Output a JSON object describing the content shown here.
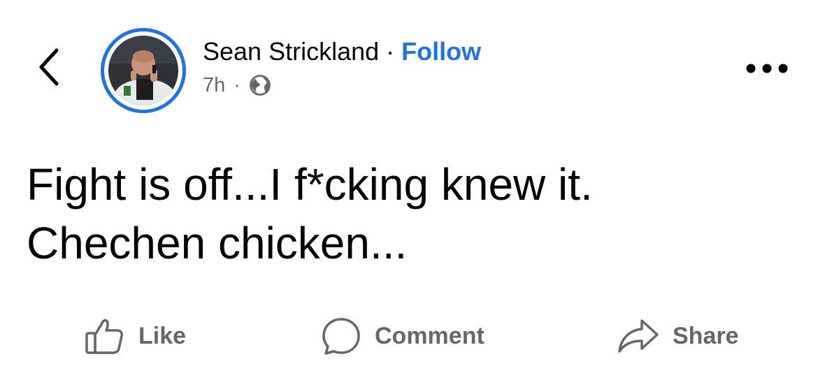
{
  "header": {
    "author_name": "Sean Strickland",
    "separator": "·",
    "follow_label": "Follow",
    "timestamp": "7h",
    "meta_separator": "·",
    "audience_icon": "globe-icon",
    "back_icon": "chevron-left-icon",
    "more_icon": "more-horizontal-icon"
  },
  "post": {
    "lines": [
      "Fight is off...I f*cking knew it.",
      "Chechen chicken..."
    ]
  },
  "actions": {
    "like_label": "Like",
    "comment_label": "Comment",
    "share_label": "Share"
  },
  "colors": {
    "accent": "#1b74e4",
    "text_primary": "#050505",
    "text_secondary": "#65676b"
  }
}
